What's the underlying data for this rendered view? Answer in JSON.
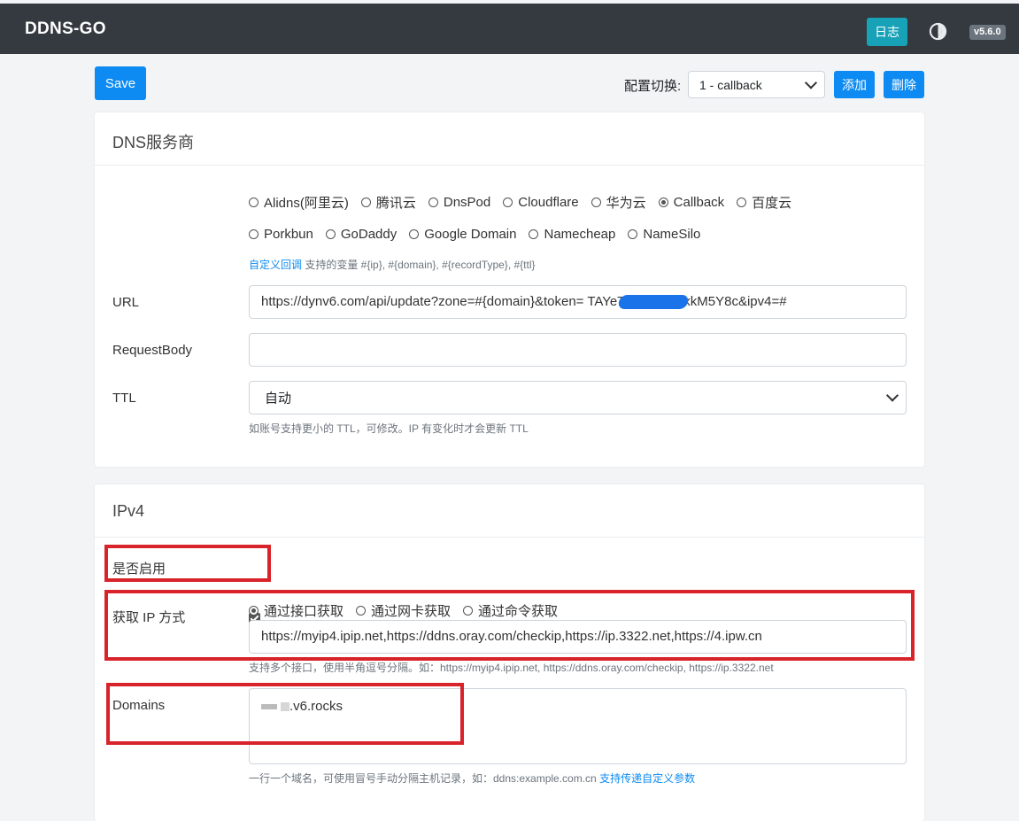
{
  "header": {
    "brand": "DDNS-GO",
    "log_button": "日志",
    "version": "v5.6.0"
  },
  "toolbar": {
    "save_label": "Save",
    "switch_label": "配置切换:",
    "switch_value": "1 - callback",
    "add_label": "添加",
    "delete_label": "删除"
  },
  "dns": {
    "title": "DNS服务商",
    "providers_row1": [
      {
        "label": "Alidns(阿里云)",
        "checked": false
      },
      {
        "label": "腾讯云",
        "checked": false
      },
      {
        "label": "DnsPod",
        "checked": false
      },
      {
        "label": "Cloudflare",
        "checked": false
      },
      {
        "label": "华为云",
        "checked": false
      },
      {
        "label": "Callback",
        "checked": true
      },
      {
        "label": "百度云",
        "checked": false
      }
    ],
    "providers_row2": [
      {
        "label": "Porkbun",
        "checked": false
      },
      {
        "label": "GoDaddy",
        "checked": false
      },
      {
        "label": "Google Domain",
        "checked": false
      },
      {
        "label": "Namecheap",
        "checked": false
      },
      {
        "label": "NameSilo",
        "checked": false
      }
    ],
    "callback_link": "自定义回调",
    "callback_help": " 支持的变量 #{ip}, #{domain}, #{recordType}, #{ttl}",
    "url_label": "URL",
    "url_value": "https://dynv6.com/api/update?zone=#{domain}&token=                                    TAYeT1ya5P6xyxkM5Y8c&ipv4=#",
    "request_body_label": "RequestBody",
    "request_body_value": "",
    "ttl_label": "TTL",
    "ttl_value": "自动",
    "ttl_help": "如账号支持更小的 TTL，可修改。IP 有变化时才会更新 TTL"
  },
  "ipv4": {
    "title": "IPv4",
    "enable_label": "是否启用",
    "enabled": true,
    "method_label": "获取 IP 方式",
    "methods": [
      {
        "label": "通过接口获取",
        "checked": true
      },
      {
        "label": "通过网卡获取",
        "checked": false
      },
      {
        "label": "通过命令获取",
        "checked": false
      }
    ],
    "url_value": "https://myip4.ipip.net,https://ddns.oray.com/checkip,https://ip.3322.net,https://4.ipw.cn",
    "url_help": "支持多个接口，使用半角逗号分隔。如：https://myip4.ipip.net, https://ddns.oray.com/checkip, https://ip.3322.net",
    "domains_label": "Domains",
    "domains_value": ".v6.rocks",
    "domains_help": "一行一个域名，可使用冒号手动分隔主机记录，如：ddns:example.com.cn ",
    "domains_link": "支持传递自定义参数"
  }
}
